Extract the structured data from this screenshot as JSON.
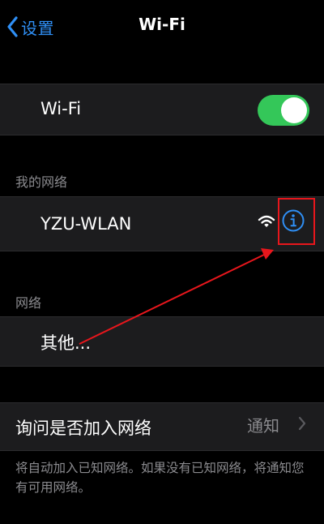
{
  "nav": {
    "back_label": "设置",
    "title": "Wi-Fi"
  },
  "wifi_toggle": {
    "label": "Wi-Fi",
    "on": true
  },
  "my_networks": {
    "header": "我的网络",
    "networks": [
      {
        "name": "YZU-WLAN",
        "icon": "wifi-signal-icon",
        "action_icon": "info-icon"
      }
    ]
  },
  "networks": {
    "header": "网络",
    "other_label": "其他..."
  },
  "ask_to_join": {
    "label": "询问是否加入网络",
    "value": "通知"
  },
  "footer_note": "将自动加入已知网络。如果没有已知网络，将通知您有可用网络。",
  "colors": {
    "accent": "#2f8ff5",
    "toggle_on": "#34c759",
    "annotation": "#e8161c"
  }
}
